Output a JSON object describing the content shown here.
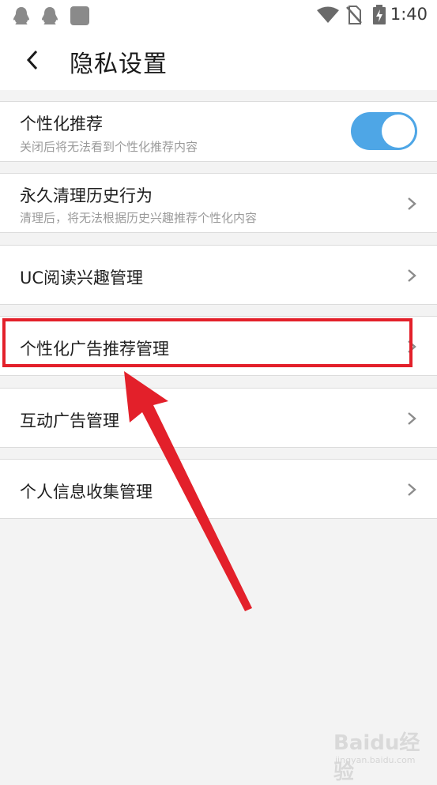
{
  "status_bar": {
    "time": "1:40",
    "icons": [
      "qq-penguin-icon",
      "qq-penguin-icon",
      "app-square-icon",
      "wifi-icon",
      "no-sim-icon",
      "battery-charging-icon"
    ]
  },
  "header": {
    "back_icon": "chevron-left-icon",
    "title": "隐私设置"
  },
  "settings": [
    {
      "title": "个性化推荐",
      "subtitle": "关闭后将无法看到个性化推荐内容",
      "control": "toggle",
      "toggle_on": true
    },
    {
      "title": "永久清理历史行为",
      "subtitle": "清理后，将无法根据历史兴趣推荐个性化内容",
      "control": "chevron"
    },
    {
      "title": "UC阅读兴趣管理",
      "control": "chevron"
    },
    {
      "title": "个性化广告推荐管理",
      "control": "chevron",
      "highlighted": true
    },
    {
      "title": "互动广告管理",
      "control": "chevron"
    },
    {
      "title": "个人信息收集管理",
      "control": "chevron"
    }
  ],
  "annotation": {
    "highlight_color": "#e3202a",
    "arrow_color": "#e3202a"
  },
  "colors": {
    "toggle_on": "#4ea6e6",
    "background": "#f3f3f3"
  },
  "watermark": {
    "logo": "Baidu经验",
    "sub": "jingyan.baidu.com"
  }
}
